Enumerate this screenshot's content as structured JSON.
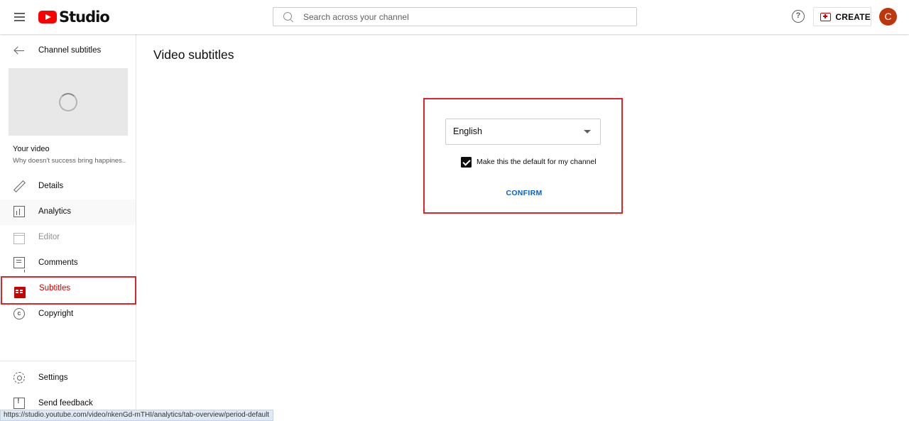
{
  "header": {
    "logo_text": "Studio",
    "search_placeholder": "Search across your channel",
    "help_glyph": "?",
    "create_label": "CREATE",
    "avatar_letter": "C"
  },
  "sidebar": {
    "back_label": "Channel subtitles",
    "your_video_label": "Your video",
    "video_title": "Why doesn't success bring happines...",
    "items": [
      {
        "label": "Details",
        "icon": "pencil-icon"
      },
      {
        "label": "Analytics",
        "icon": "analytics-icon"
      },
      {
        "label": "Editor",
        "icon": "editor-icon"
      },
      {
        "label": "Comments",
        "icon": "comments-icon"
      },
      {
        "label": "Subtitles",
        "icon": "subtitles-icon"
      },
      {
        "label": "Copyright",
        "icon": "copyright-icon"
      }
    ],
    "bottom_items": [
      {
        "label": "Settings",
        "icon": "settings-icon"
      },
      {
        "label": "Send feedback",
        "icon": "feedback-icon"
      }
    ]
  },
  "main": {
    "title": "Video subtitles",
    "dialog": {
      "language_value": "English",
      "checkbox_checked": true,
      "checkbox_label": "Make this the default for my channel",
      "confirm_label": "CONFIRM"
    }
  },
  "statusbar": {
    "url": "https://studio.youtube.com/video/nkenGd-mTHI/analytics/tab-overview/period-default"
  },
  "colors": {
    "brand_red": "#ff0000",
    "active_red": "#cc0000",
    "highlight_border": "#d8262c",
    "link_blue": "#065fd4",
    "avatar_bg": "#bf360c"
  }
}
